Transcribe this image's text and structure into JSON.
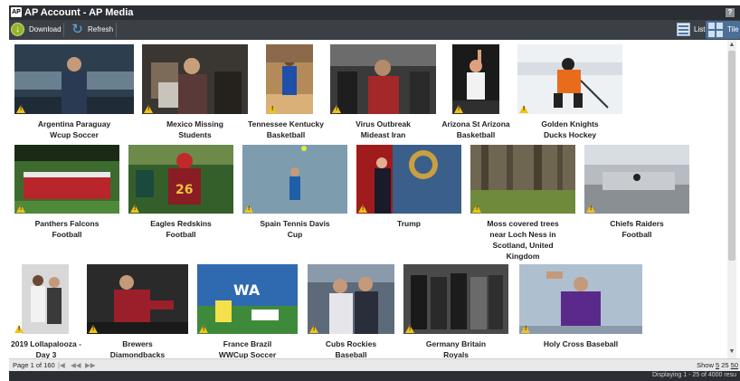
{
  "window": {
    "logo": "AP",
    "title": "AP Account - AP Media",
    "help": "?"
  },
  "toolbar": {
    "download": "Download",
    "refresh": "Refresh",
    "list": "List",
    "tile": "Tile"
  },
  "tiles": [
    {
      "line1": "Argentina Paraguay",
      "line2": "Wcup Soccer"
    },
    {
      "line1": "Mexico Missing",
      "line2": "Students"
    },
    {
      "line1": "Tennessee Kentucky",
      "line2": "Basketball"
    },
    {
      "line1": "Virus Outbreak",
      "line2": "Mideast Iran"
    },
    {
      "line1": "Arizona St Arizona",
      "line2": "Basketball"
    },
    {
      "line1": "Golden Knights",
      "line2": "Ducks Hockey"
    },
    {
      "line1": "Panthers Falcons",
      "line2": "Football"
    },
    {
      "line1": "Eagles Redskins",
      "line2": "Football"
    },
    {
      "line1": "Spain Tennis Davis",
      "line2": "Cup"
    },
    {
      "line1": "Trump",
      "line2": ""
    },
    {
      "line1": "Moss covered trees",
      "line2": "near Loch Ness in",
      "line3": "Scotland, United",
      "line4": "Kingdom"
    },
    {
      "line1": "Chiefs Raiders",
      "line2": "Football"
    },
    {
      "line1": "2019 Lollapalooza -",
      "line2": "Day 3"
    },
    {
      "line1": "Brewers",
      "line2": "Diamondbacks"
    },
    {
      "line1": "France Brazil",
      "line2": "WWCup Soccer"
    },
    {
      "line1": "Cubs Rockies",
      "line2": "Baseball"
    },
    {
      "line1": "Germany Britain",
      "line2": "Royals"
    },
    {
      "line1": "Holy Cross Baseball",
      "line2": ""
    }
  ],
  "pager": {
    "page_info": "Page 1 of 160",
    "show_label": "Show",
    "opt1": "5",
    "opt2": "25",
    "opt3": "50"
  },
  "status": {
    "text": "Displaying 1 - 25 of 4000 resu"
  },
  "colors": {
    "titlebar": "#2b2f33",
    "toolbar": "#3b4046",
    "warning": "#f2c21b",
    "tile_active": "#4c6f96"
  }
}
